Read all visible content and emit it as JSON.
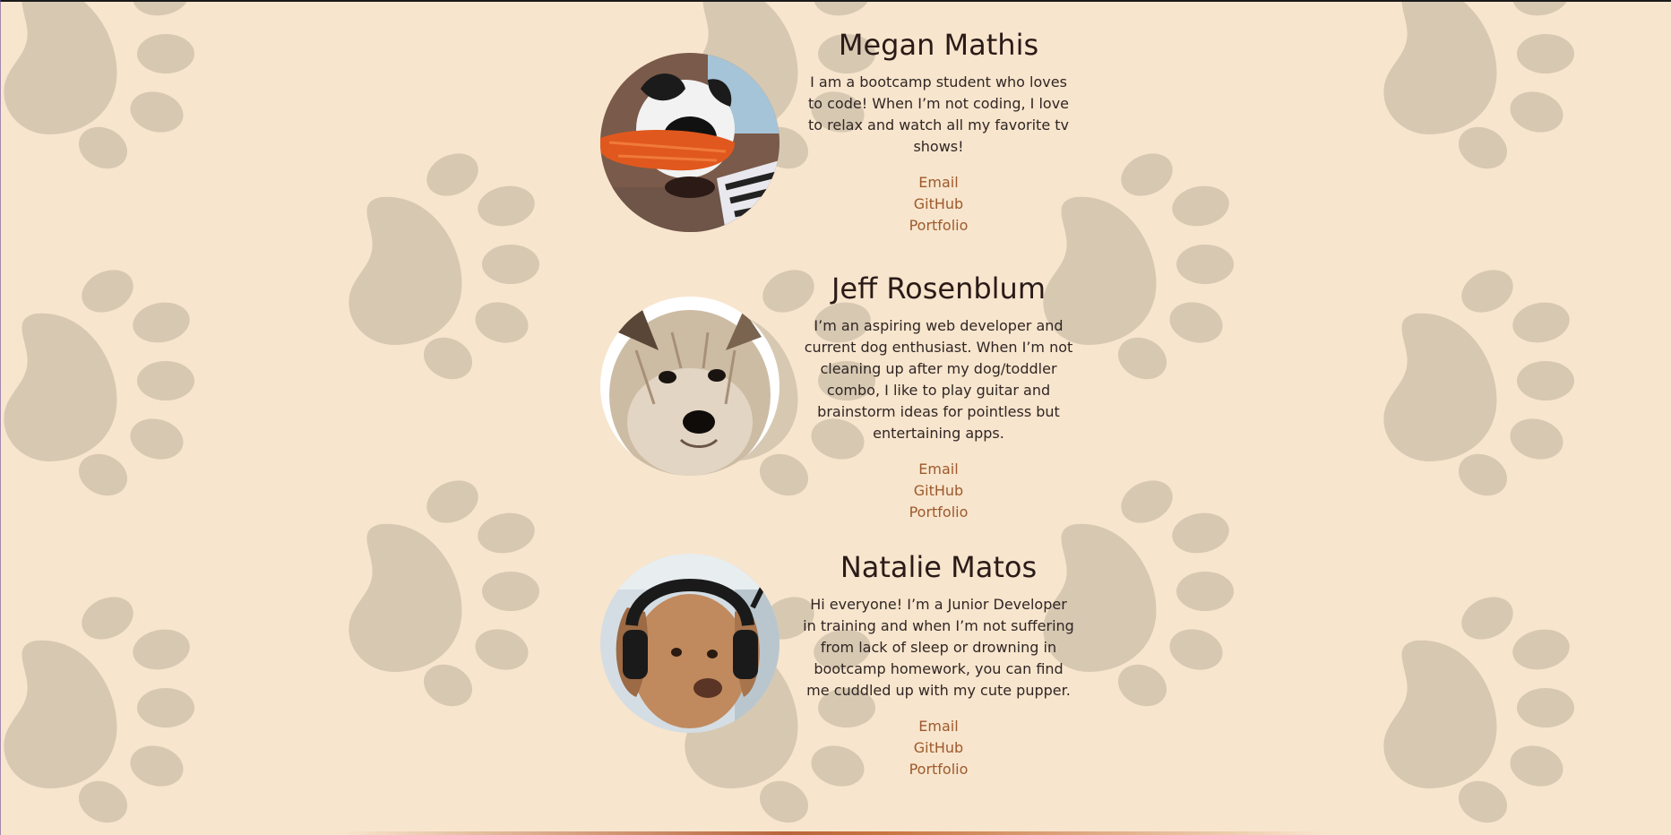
{
  "theme": {
    "background": "#f8e5cd",
    "paw_color": "#d7c8b2",
    "link_color": "#9c5a2c",
    "text_color": "#2a1b18"
  },
  "profiles": [
    {
      "name": "Megan Mathis",
      "bio": "I am a bootcamp student who loves to code! When I’m not coding, I love to relax and watch all my favorite tv shows!",
      "photo_icon": "dog-with-toy-photo",
      "links": {
        "email": "Email",
        "github": "GitHub",
        "portfolio": "Portfolio"
      }
    },
    {
      "name": "Jeff Rosenblum",
      "bio": "I’m an aspiring web developer and current dog enthusiast. When I’m not cleaning up after my dog/toddler combo, I like to play guitar and brainstorm ideas for pointless but entertaining apps.",
      "photo_icon": "terrier-dog-photo",
      "links": {
        "email": "Email",
        "github": "GitHub",
        "portfolio": "Portfolio"
      }
    },
    {
      "name": "Natalie Matos",
      "bio": "Hi everyone! I’m a Junior Developer in training and when I’m not suffering from lack of sleep or drowning in bootcamp homework, you can find me cuddled up with my cute pupper.",
      "photo_icon": "dog-with-headphones-photo",
      "links": {
        "email": "Email",
        "github": "GitHub",
        "portfolio": "Portfolio"
      }
    }
  ]
}
